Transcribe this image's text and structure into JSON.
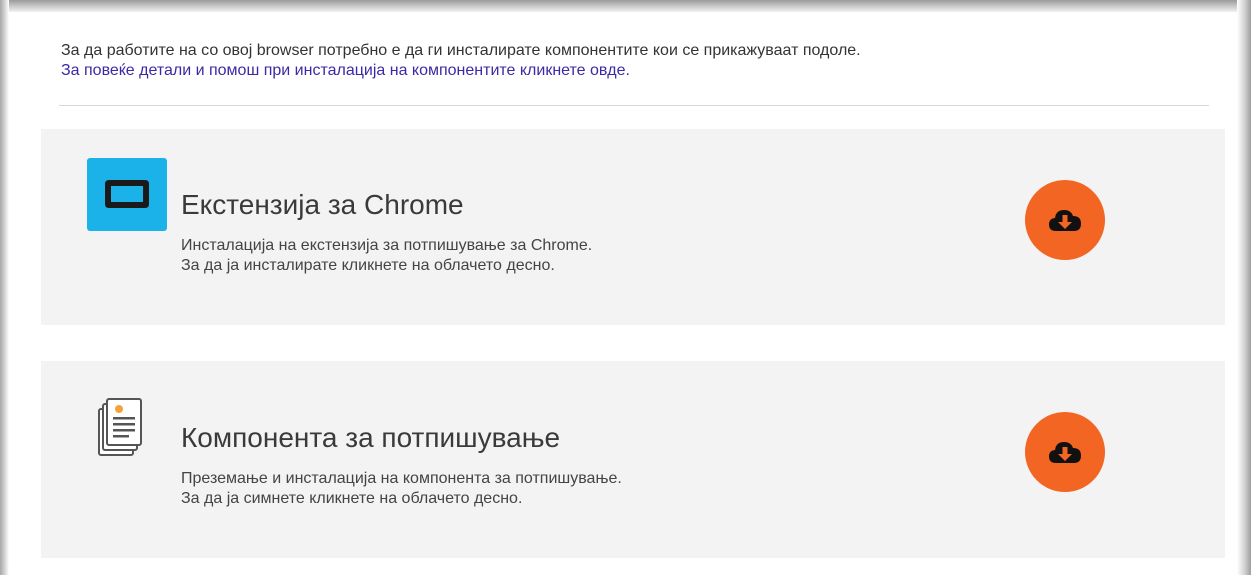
{
  "intro": {
    "text": "За да работите на со овој browser потребно е да ги инсталирате компонентите кои се прикажуваат подоле.",
    "help_link": "За повеќе детали и помош при инсталација на компонентите кликнете овде."
  },
  "components": [
    {
      "icon": "chrome-extension-icon",
      "title": "Екстензија за Chrome",
      "desc_line1": "Инсталација на екстензија за потпишување за Chrome.",
      "desc_line2": "За да ја инсталирате кликнете на облачето десно.",
      "button_icon": "cloud-download-icon"
    },
    {
      "icon": "documents-icon",
      "title": "Компонента за потпишување",
      "desc_line1": "Преземање и инсталација на компонента за потпишување.",
      "desc_line2": "За да ја симнете кликнете на облачето десно.",
      "button_icon": "cloud-download-icon"
    }
  ],
  "colors": {
    "accent_orange": "#f26522",
    "chrome_icon_blue": "#1ab2e8",
    "link": "#3b2aa6",
    "card_bg": "#f3f3f3"
  }
}
